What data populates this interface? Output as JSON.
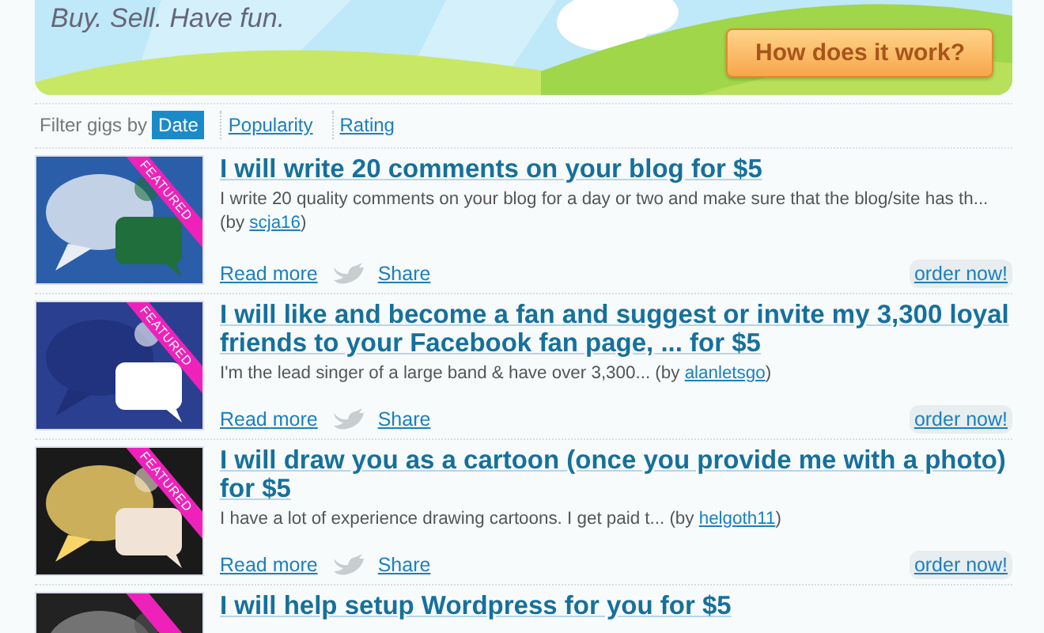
{
  "banner": {
    "tagline": "Buy. Sell. Have fun.",
    "button": "How does it work?"
  },
  "filter": {
    "label": "Filter gigs by",
    "options": [
      {
        "label": "Date",
        "selected": true
      },
      {
        "label": "Popularity",
        "selected": false
      },
      {
        "label": "Rating",
        "selected": false
      }
    ]
  },
  "gigs": [
    {
      "ribbon": "FEATURED",
      "title": "I will write 20 comments on your blog for $5",
      "description": "I write 20 quality comments on your blog for a day or two and make sure that the blog/site has th... (by ",
      "author": "scja16",
      "description_end": ")",
      "read_more": "Read more",
      "share": "Share",
      "order": "order now!"
    },
    {
      "ribbon": "FEATURED",
      "title": "I will like and become a fan and suggest or invite my 3,300 loyal friends to your Facebook fan page, ... for $5",
      "description": "I'm the lead singer of a large band & have over 3,300... (by ",
      "author": "alanletsgo",
      "description_end": ")",
      "read_more": "Read more",
      "share": "Share",
      "order": "order now!"
    },
    {
      "ribbon": "FEATURED",
      "title": "I will draw you as a cartoon (once you provide me with a photo) for $5",
      "description": "I have a lot of experience drawing cartoons. I get paid t... (by ",
      "author": "helgoth11",
      "description_end": ")",
      "read_more": "Read more",
      "share": "Share",
      "order": "order now!"
    },
    {
      "featured": true,
      "title": "I will help setup Wordpress for you for $5"
    }
  ]
}
